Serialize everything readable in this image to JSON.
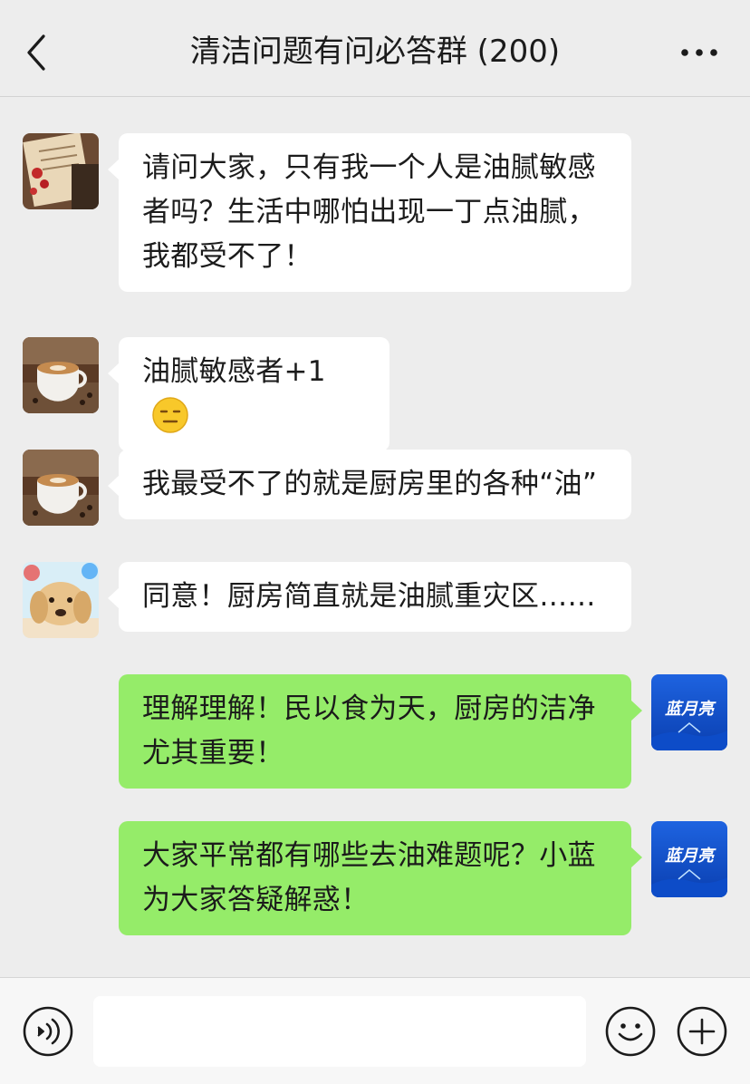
{
  "header": {
    "title": "清洁问题有问必答群 (200)",
    "back_icon": "chevron-left-icon",
    "more_icon": "more-dots-icon"
  },
  "messages": [
    {
      "side": "left",
      "avatar": "avatar-paper-roses",
      "text": "请问大家，只有我一个人是油腻敏感者吗？生活中哪怕出现一丁点油腻，我都受不了！"
    },
    {
      "side": "left",
      "avatar": "avatar-coffee-cup",
      "text": "油腻敏感者+1",
      "emoji": "expressionless-face-emoji"
    },
    {
      "side": "left",
      "avatar": "avatar-coffee-cup",
      "text": "我最受不了的就是厨房里的各种“油”"
    },
    {
      "side": "left",
      "avatar": "avatar-golden-retriever",
      "text": "同意！厨房简直就是油腻重灾区……"
    },
    {
      "side": "right",
      "avatar": "avatar-bluemoon",
      "avatar_text": "蓝月亮",
      "text": "理解理解！民以食为天，厨房的洁净尤其重要！"
    },
    {
      "side": "right",
      "avatar": "avatar-bluemoon",
      "avatar_text": "蓝月亮",
      "text": "大家平常都有哪些去油难题呢？小蓝为大家答疑解惑！"
    }
  ],
  "footer": {
    "input_value": "",
    "voice_icon": "voice-icon",
    "emoji_icon": "emoji-icon",
    "plus_icon": "plus-icon"
  },
  "colors": {
    "background": "#ededed",
    "left_bubble": "#ffffff",
    "right_bubble": "#95ec69",
    "brand_blue": "#1a5fd6"
  }
}
